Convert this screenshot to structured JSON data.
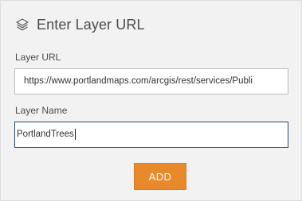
{
  "dialog": {
    "title": "Enter Layer URL",
    "title_icon": "layers-icon"
  },
  "form": {
    "url": {
      "label": "Layer URL",
      "value": "https://www.portlandmaps.com/arcgis/rest/services/Publi"
    },
    "name": {
      "label": "Layer Name",
      "value": "PortlandTrees"
    },
    "add_button_label": "ADD"
  },
  "colors": {
    "panel_background": "#f2f2f2",
    "add_button": "#e88a2c",
    "focused_border": "#27456b"
  }
}
